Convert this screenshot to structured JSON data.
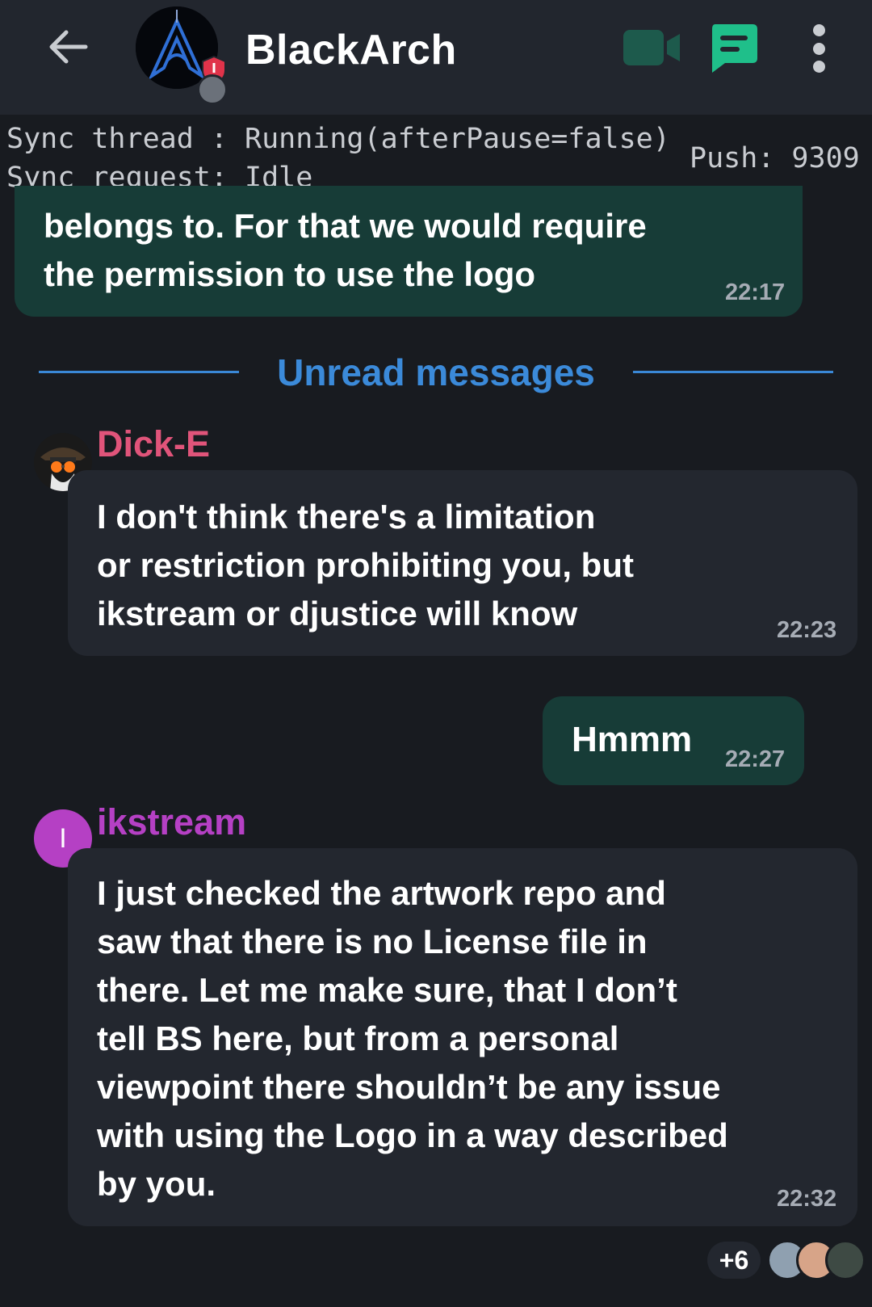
{
  "header": {
    "title": "BlackArch",
    "back_icon": "arrow-left-icon",
    "video_icon": "video-camera-icon",
    "threads_icon": "threads-chat-icon",
    "more_icon": "more-vert-icon"
  },
  "debug": {
    "line1": "Sync thread : Running(afterPause=false)",
    "line2": "Sync request: Idle",
    "push": "Push: 9309"
  },
  "messages": {
    "m0": {
      "text": "belongs to. For that we would require\nthe permission to use the logo",
      "time": "22:17"
    },
    "unread": "Unread messages",
    "m1": {
      "sender": "Dick-E",
      "text": "I don't think there's a limitation\nor restriction prohibiting you, but\nikstream or djustice will know",
      "time": "22:23"
    },
    "m2": {
      "text": "Hmmm",
      "time": "22:27"
    },
    "m3": {
      "sender": "ikstream",
      "avatar_letter": "I",
      "text": "I just checked the artwork repo and\nsaw that there is no License file in\nthere. Let me make sure, that I don’t\ntell BS here, but from a personal\nviewpoint there shouldn’t be any issue\nwith using the Logo in a way described\nby you.",
      "time": "22:32"
    }
  },
  "receipts": {
    "count": "+6"
  },
  "colors": {
    "accent_green": "#1fbf8a",
    "outgoing_bubble": "#173c37",
    "incoming_bubble": "#23272f",
    "unread_blue": "#3b8ad9",
    "dicke_name": "#e0547a",
    "ikstream_name": "#b540c4"
  }
}
